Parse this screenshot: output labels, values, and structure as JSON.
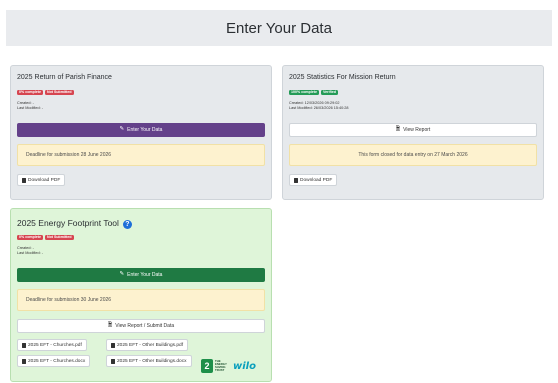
{
  "page": {
    "title": "Enter Your Data"
  },
  "cards": [
    {
      "title": "2025 Return of Parish Finance",
      "badges": [
        "0% complete",
        "Not Submitted"
      ],
      "created": "Created: -",
      "modified": "Last Modified: -",
      "action_label": "Enter Your Data",
      "notice": "Deadline for submission 28 June 2026",
      "download_label": "Download PDF"
    },
    {
      "title": "2025 Statistics For Mission Return",
      "badges": [
        "100% complete",
        "Verified"
      ],
      "created": "Created: 12/03/2026 09:29:02",
      "modified": "Last Modified: 26/03/2026 15:40:28",
      "action_label": "View Report",
      "notice": "This form closed for data entry on 27 March 2026",
      "download_label": "Download PDF"
    },
    {
      "title": "2025 Energy Footprint Tool",
      "badges": [
        "0% complete",
        "Not Submitted"
      ],
      "created": "Created: -",
      "modified": "Last Modified: -",
      "action_label": "Enter Your Data",
      "notice": "Deadline for submission 30 June 2026",
      "view_label": "View Report / Submit Data",
      "files": [
        "2025 EFT - Churches.pdf",
        "2025 EFT - Other Buildings.pdf",
        "2025 EFT - Churches.docx",
        "2025 EFT - Other Buildings.docx"
      ],
      "sponsor": {
        "logo_text": "THE ENERGY SAVING TRUST",
        "brand": "wilo"
      }
    }
  ]
}
